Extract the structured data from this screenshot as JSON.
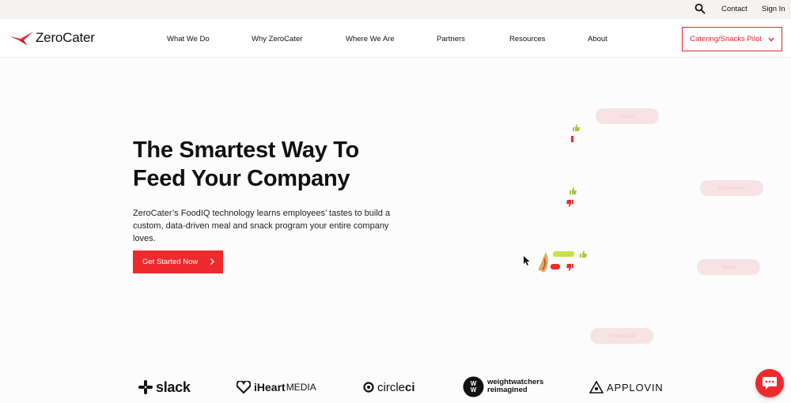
{
  "topbar": {
    "contact_label": "Contact",
    "signin_label": "Sign In",
    "search_icon": "search-icon"
  },
  "nav": {
    "logo_text": "ZeroCater",
    "items": [
      "What We Do",
      "Why ZeroCater",
      "Where We Are",
      "Partners",
      "Resources",
      "About"
    ],
    "pilot_label": "Catering/Snacks Pilot"
  },
  "hero": {
    "title_line1": "The Smartest Way To",
    "title_line2": "Feed Your Company",
    "subtitle": "ZeroCater’s FoodIQ technology learns employees’ tastes to build a custom, data-driven meal and snack program your entire company loves.",
    "cta_label": "Get Started Now"
  },
  "animation": {
    "pills": [
      "Italian",
      "Vietnamese",
      "Salad",
      "Protein Bar"
    ]
  },
  "brands": {
    "slack": "slack",
    "iheart_a": "iHeart",
    "iheart_b": "MEDIA",
    "circleci_a": "circle",
    "circleci_b": "ci",
    "ww_a": "weightwatchers",
    "ww_b": "reimagined",
    "applovin": "APPLOVIN"
  },
  "colors": {
    "brand_red": "#ee2a2d",
    "topbar_bg": "#f6f2f1",
    "thumb_up": "#a6c93a"
  }
}
